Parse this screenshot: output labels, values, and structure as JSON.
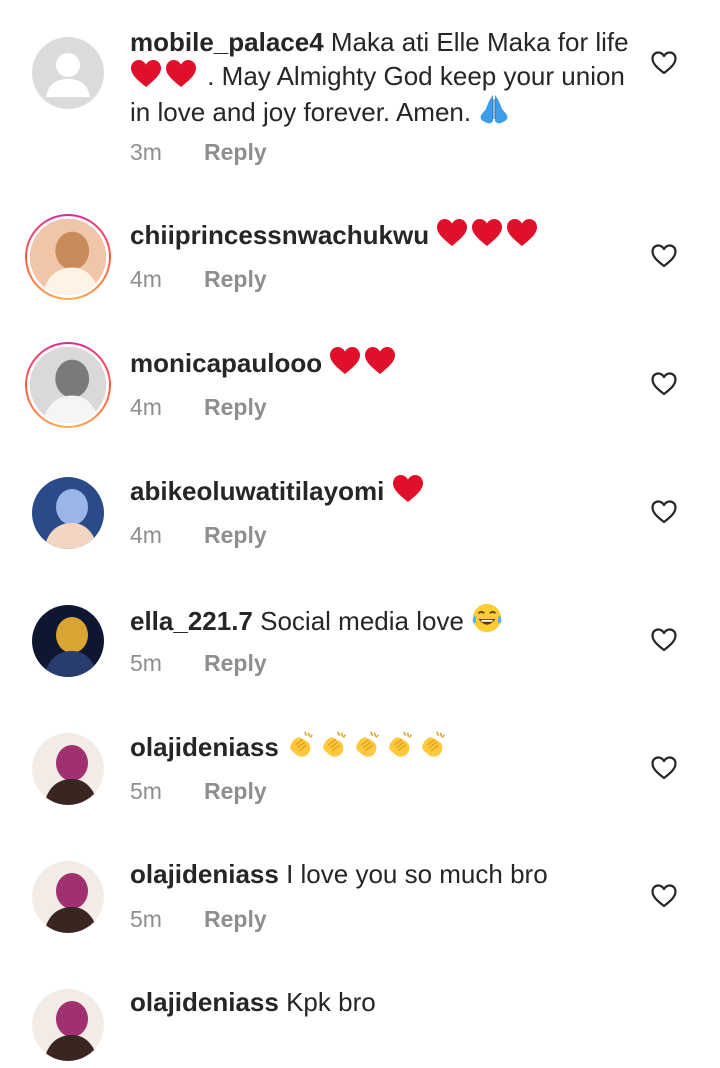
{
  "comments": [
    {
      "username": "mobile_palace4",
      "text_parts": [
        "Maka ati Elle Maka for life",
        " . May Almighty God keep your union in love and joy forever. Amen. "
      ],
      "emojis": [
        "red-heart",
        "red-heart",
        "folded-hands"
      ],
      "time": "3m",
      "reply_label": "Reply",
      "avatar": "default-avatar"
    },
    {
      "username": "chiiprincessnwachukwu",
      "text": "",
      "emojis": [
        "red-heart",
        "red-heart",
        "red-heart"
      ],
      "time": "4m",
      "reply_label": "Reply",
      "avatar": "photo-avatar",
      "story_ring": true
    },
    {
      "username": "monicapaulooo",
      "text": "",
      "emojis": [
        "red-heart",
        "red-heart"
      ],
      "time": "4m",
      "reply_label": "Reply",
      "avatar": "photo-avatar",
      "story_ring": true
    },
    {
      "username": "abikeoluwatitilayomi",
      "text": "",
      "emojis": [
        "red-heart"
      ],
      "time": "4m",
      "reply_label": "Reply",
      "avatar": "photo-avatar"
    },
    {
      "username": "ella_221.7",
      "text": "Social media love",
      "emojis": [
        "tears-of-joy"
      ],
      "time": "5m",
      "reply_label": "Reply",
      "avatar": "photo-avatar"
    },
    {
      "username": "olajideniass",
      "text": "",
      "emojis": [
        "clapping-hands",
        "clapping-hands",
        "clapping-hands",
        "clapping-hands",
        "clapping-hands"
      ],
      "time": "5m",
      "reply_label": "Reply",
      "avatar": "photo-avatar"
    },
    {
      "username": "olajideniass",
      "text": "I love you so much bro",
      "emojis": [],
      "time": "5m",
      "reply_label": "Reply",
      "avatar": "photo-avatar"
    },
    {
      "username": "olajideniass",
      "text": "Kpk bro",
      "emojis": [],
      "avatar": "photo-avatar"
    }
  ],
  "colors": {
    "text": "#262626",
    "secondary": "#8e8e8e",
    "heart_emoji": "#e0102b",
    "story_ring": [
      "#d6249f",
      "#fd5949",
      "#fdb14a"
    ]
  },
  "icons": {
    "like": "heart-outline-icon"
  }
}
